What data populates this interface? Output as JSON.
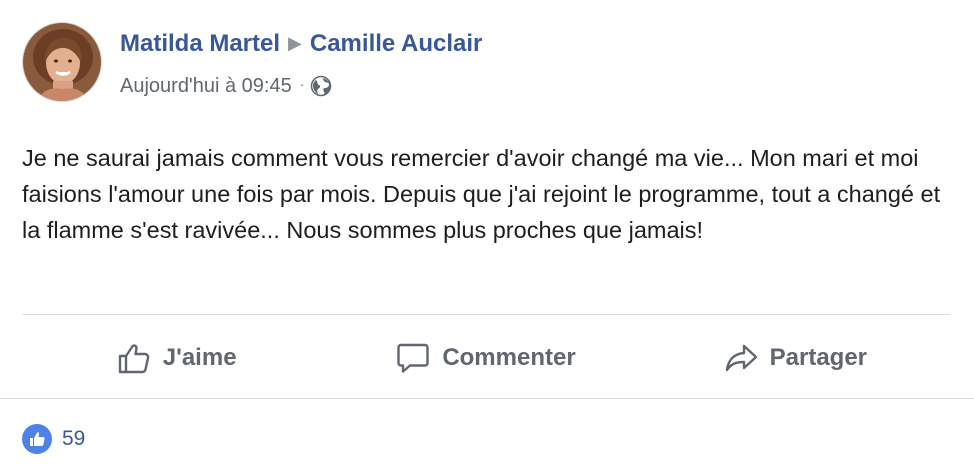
{
  "post": {
    "author": "Matilda Martel",
    "recipient": "Camille Auclair",
    "timestamp": "Aujourd'hui à 09:45",
    "separator_dot": "·",
    "privacy_icon": "globe-icon",
    "text": "Je ne saurai jamais comment vous remercier d'avoir changé ma vie... Mon mari et moi faisions l'amour une fois par mois. Depuis que j'ai rejoint le programme, tout a changé et la flamme s'est ravivée... Nous sommes plus proches que jamais!"
  },
  "actions": {
    "like_label": "J'aime",
    "comment_label": "Commenter",
    "share_label": "Partager"
  },
  "reactions": {
    "like_count": "59"
  },
  "colors": {
    "name_link": "#385898",
    "meta_text": "#616770",
    "action_text": "#606770",
    "like_badge": "#4f82e8"
  }
}
